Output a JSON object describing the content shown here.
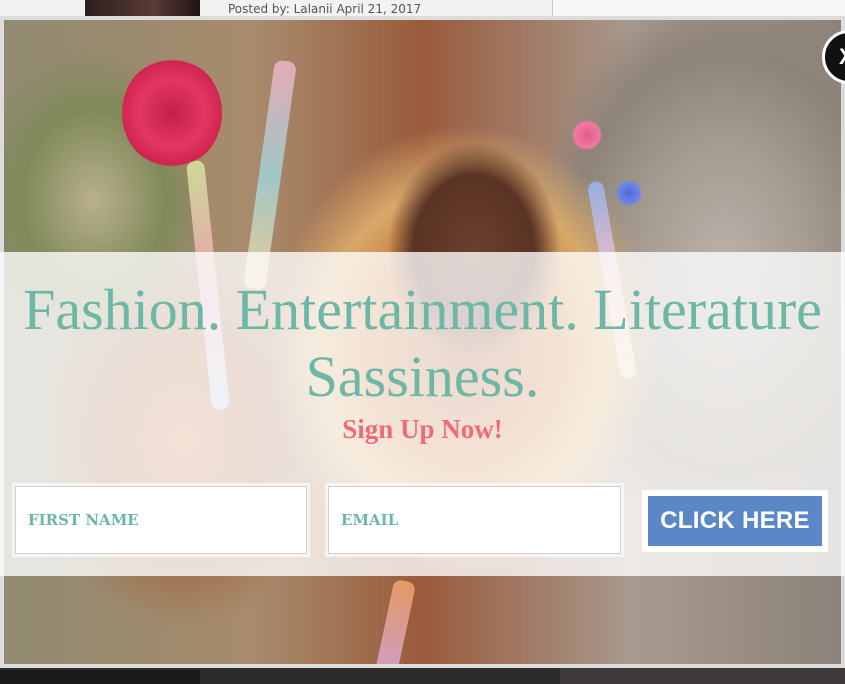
{
  "page": {
    "posted_line": "Posted by: Lalanii April 21, 2017"
  },
  "popup": {
    "close_label": "X",
    "headline_line1": "Fashion. Entertainment. Literature",
    "headline_line2": "Sassiness.",
    "cta_text": "Sign Up Now!",
    "first_name": {
      "placeholder": "FIRST NAME",
      "value": ""
    },
    "email": {
      "placeholder": "EMAIL",
      "value": ""
    },
    "submit_label": "CLICK HERE"
  },
  "colors": {
    "headline": "#6cb7a5",
    "cta": "#ef6b77",
    "button": "#5b87c6"
  },
  "icons": {
    "close": "close-icon"
  }
}
